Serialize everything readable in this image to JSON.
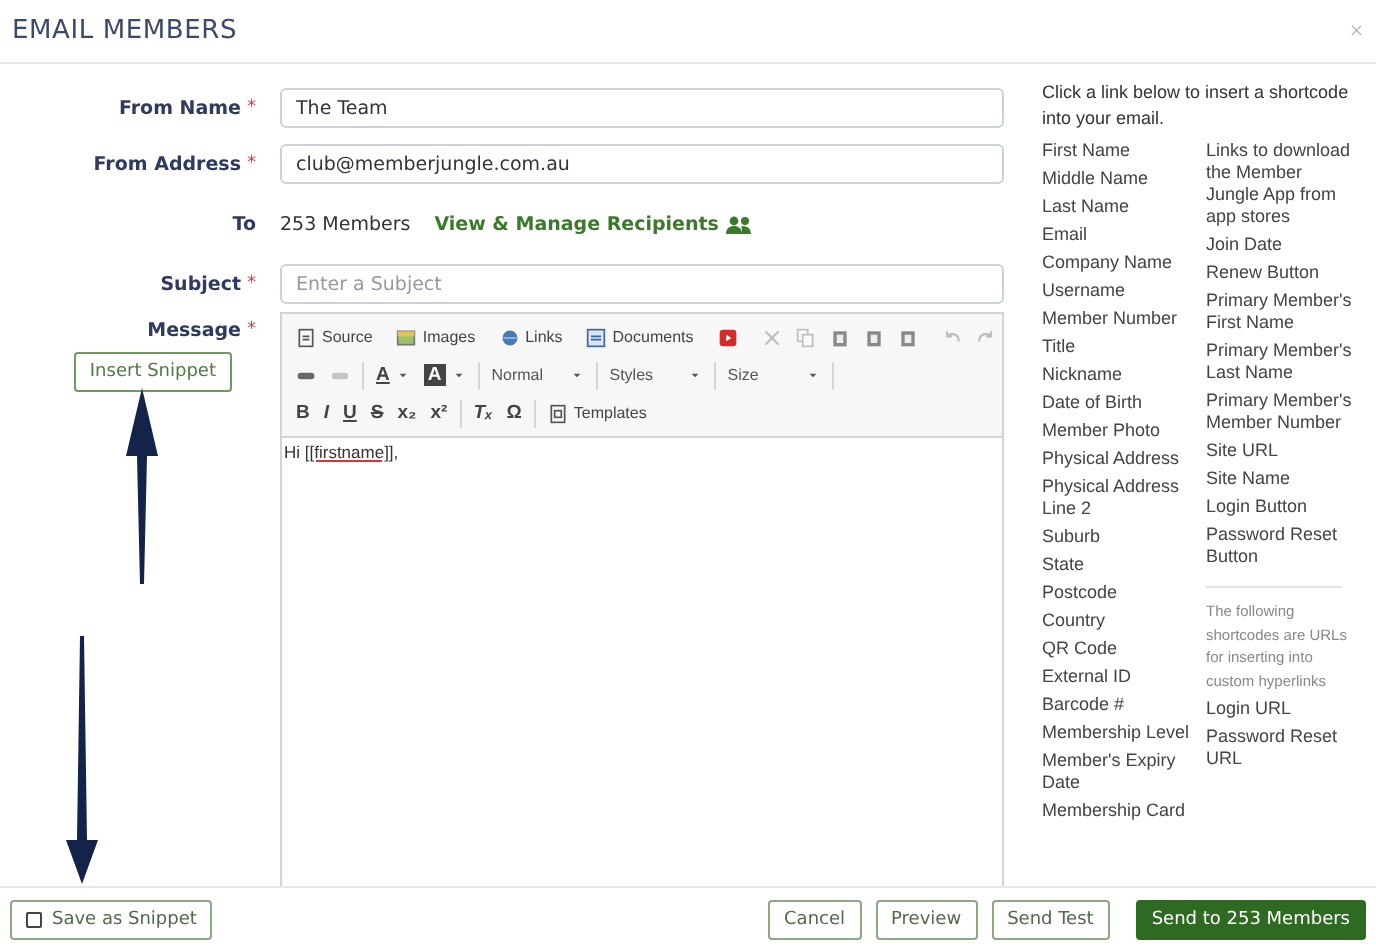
{
  "window": {
    "title": "EMAIL MEMBERS",
    "close": "×"
  },
  "form": {
    "from_name": {
      "label": "From Name",
      "required_mark": "*",
      "value": "The Team"
    },
    "from_address": {
      "label": "From Address",
      "required_mark": "*",
      "value": "club@memberjungle.com.au"
    },
    "to": {
      "label": "To",
      "count": "253 Members",
      "link": "View & Manage Recipients"
    },
    "subject": {
      "label": "Subject",
      "required_mark": "*",
      "placeholder": "Enter a Subject"
    },
    "message": {
      "label": "Message",
      "required_mark": "*",
      "insert_button": "Insert Snippet",
      "body_greeting": "Hi ",
      "body_code": "[[firstname]]",
      "body_end": ","
    }
  },
  "toolbar": [
    [
      {
        "kind": "source",
        "label": "Source",
        "disabled": false
      },
      {
        "kind": "sep"
      },
      {
        "kind": "images",
        "label": "Images",
        "disabled": false
      },
      {
        "kind": "sep"
      },
      {
        "kind": "links",
        "label": "Links",
        "disabled": false
      },
      {
        "kind": "sep"
      },
      {
        "kind": "documents",
        "label": "Documents",
        "disabled": false
      },
      {
        "kind": "sep"
      },
      {
        "kind": "youtube",
        "disabled": false
      },
      {
        "kind": "sep"
      },
      {
        "kind": "cut",
        "disabled": true
      },
      {
        "kind": "copy",
        "disabled": true
      },
      {
        "kind": "paste",
        "disabled": false
      },
      {
        "kind": "paste",
        "disabled": false
      },
      {
        "kind": "paste",
        "disabled": false
      },
      {
        "kind": "sep"
      },
      {
        "kind": "undo",
        "disabled": true
      },
      {
        "kind": "redo",
        "disabled": true
      },
      {
        "kind": "sep"
      }
    ],
    [
      {
        "kind": "link",
        "disabled": false
      },
      {
        "kind": "unlink",
        "disabled": true
      },
      {
        "kind": "sep"
      },
      {
        "kind": "text-color",
        "label": "A",
        "disabled": false
      },
      {
        "kind": "bg-color",
        "label": "A",
        "disabled": false
      },
      {
        "kind": "sep"
      },
      {
        "kind": "combo",
        "label": "Normal",
        "disabled": false
      },
      {
        "kind": "sep"
      },
      {
        "kind": "combo",
        "label": "Styles",
        "disabled": false
      },
      {
        "kind": "sep"
      },
      {
        "kind": "combo",
        "label": "Size",
        "disabled": false
      },
      {
        "kind": "sep"
      }
    ],
    [
      {
        "kind": "bold",
        "label": "B",
        "disabled": false
      },
      {
        "kind": "italic",
        "label": "I",
        "disabled": false
      },
      {
        "kind": "underline",
        "label": "U",
        "disabled": false
      },
      {
        "kind": "strike",
        "label": "S",
        "disabled": false
      },
      {
        "kind": "subscript",
        "label": "x₂",
        "disabled": false
      },
      {
        "kind": "superscript",
        "label": "x²",
        "disabled": false
      },
      {
        "kind": "sep"
      },
      {
        "kind": "clear-format",
        "label": "Tₓ",
        "disabled": false
      },
      {
        "kind": "special-char",
        "label": "Ω",
        "disabled": false
      },
      {
        "kind": "sep"
      },
      {
        "kind": "templates",
        "label": "Templates",
        "disabled": false
      }
    ]
  ],
  "shortcodes": {
    "intro": "Click a link below to insert a shortcode into your email.",
    "column_1": [
      "First Name",
      "Middle Name",
      "Last Name",
      "Email",
      "Company Name",
      "Username",
      "Member Number",
      "Title",
      "Nickname",
      "Date of Birth",
      "Member Photo",
      "Physical Address",
      "Physical Address Line 2",
      "Suburb",
      "State",
      "Postcode",
      "Country",
      "QR Code",
      "External ID",
      "Barcode #",
      "Membership Level",
      "Member's Expiry Date",
      "Membership Card"
    ],
    "column_2": [
      "Links to download the Member Jungle App from app stores",
      "Join Date",
      "Renew Button",
      "Primary Member's First Name",
      "Primary Member's Last Name",
      "Primary Member's Member Number",
      "Site URL",
      "Site Name",
      "Login Button",
      "Password Reset Button"
    ],
    "url_note": "The following shortcodes are URLs for inserting into custom hyperlinks",
    "url_links": [
      "Login URL",
      "Password Reset URL"
    ]
  },
  "footer": {
    "save_snippet": {
      "label": "Save as Snippet",
      "checked": false
    },
    "buttons": [
      {
        "label": "Cancel",
        "primary": false
      },
      {
        "label": "Preview",
        "primary": false
      },
      {
        "label": "Send Test",
        "primary": false
      },
      {
        "label": "Send to 253 Members",
        "primary": true
      }
    ]
  }
}
